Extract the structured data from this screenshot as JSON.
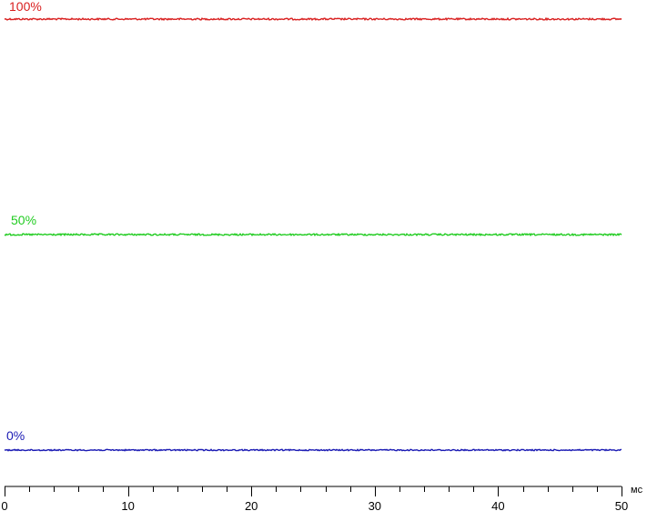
{
  "chart_data": {
    "type": "line",
    "xlabel": "мс",
    "xlim": [
      0,
      50
    ],
    "x_ticks": [
      "0",
      "10",
      "20",
      "30",
      "40",
      "50"
    ],
    "minor_tick_step": 2,
    "ylim": [
      0,
      100
    ],
    "grid": false,
    "legend": "none",
    "series": [
      {
        "name": "100%",
        "color": "#d92020",
        "level": 100,
        "noise": 0.45,
        "x": [
          0,
          50
        ],
        "y": [
          100,
          100
        ]
      },
      {
        "name": "50%",
        "color": "#22cc22",
        "level": 50,
        "noise": 0.45,
        "x": [
          0,
          50
        ],
        "y": [
          50,
          50
        ]
      },
      {
        "name": "0%",
        "color": "#1a1ab4",
        "level": 0,
        "noise": 0.35,
        "x": [
          0,
          50
        ],
        "y": [
          0,
          0
        ]
      }
    ]
  }
}
